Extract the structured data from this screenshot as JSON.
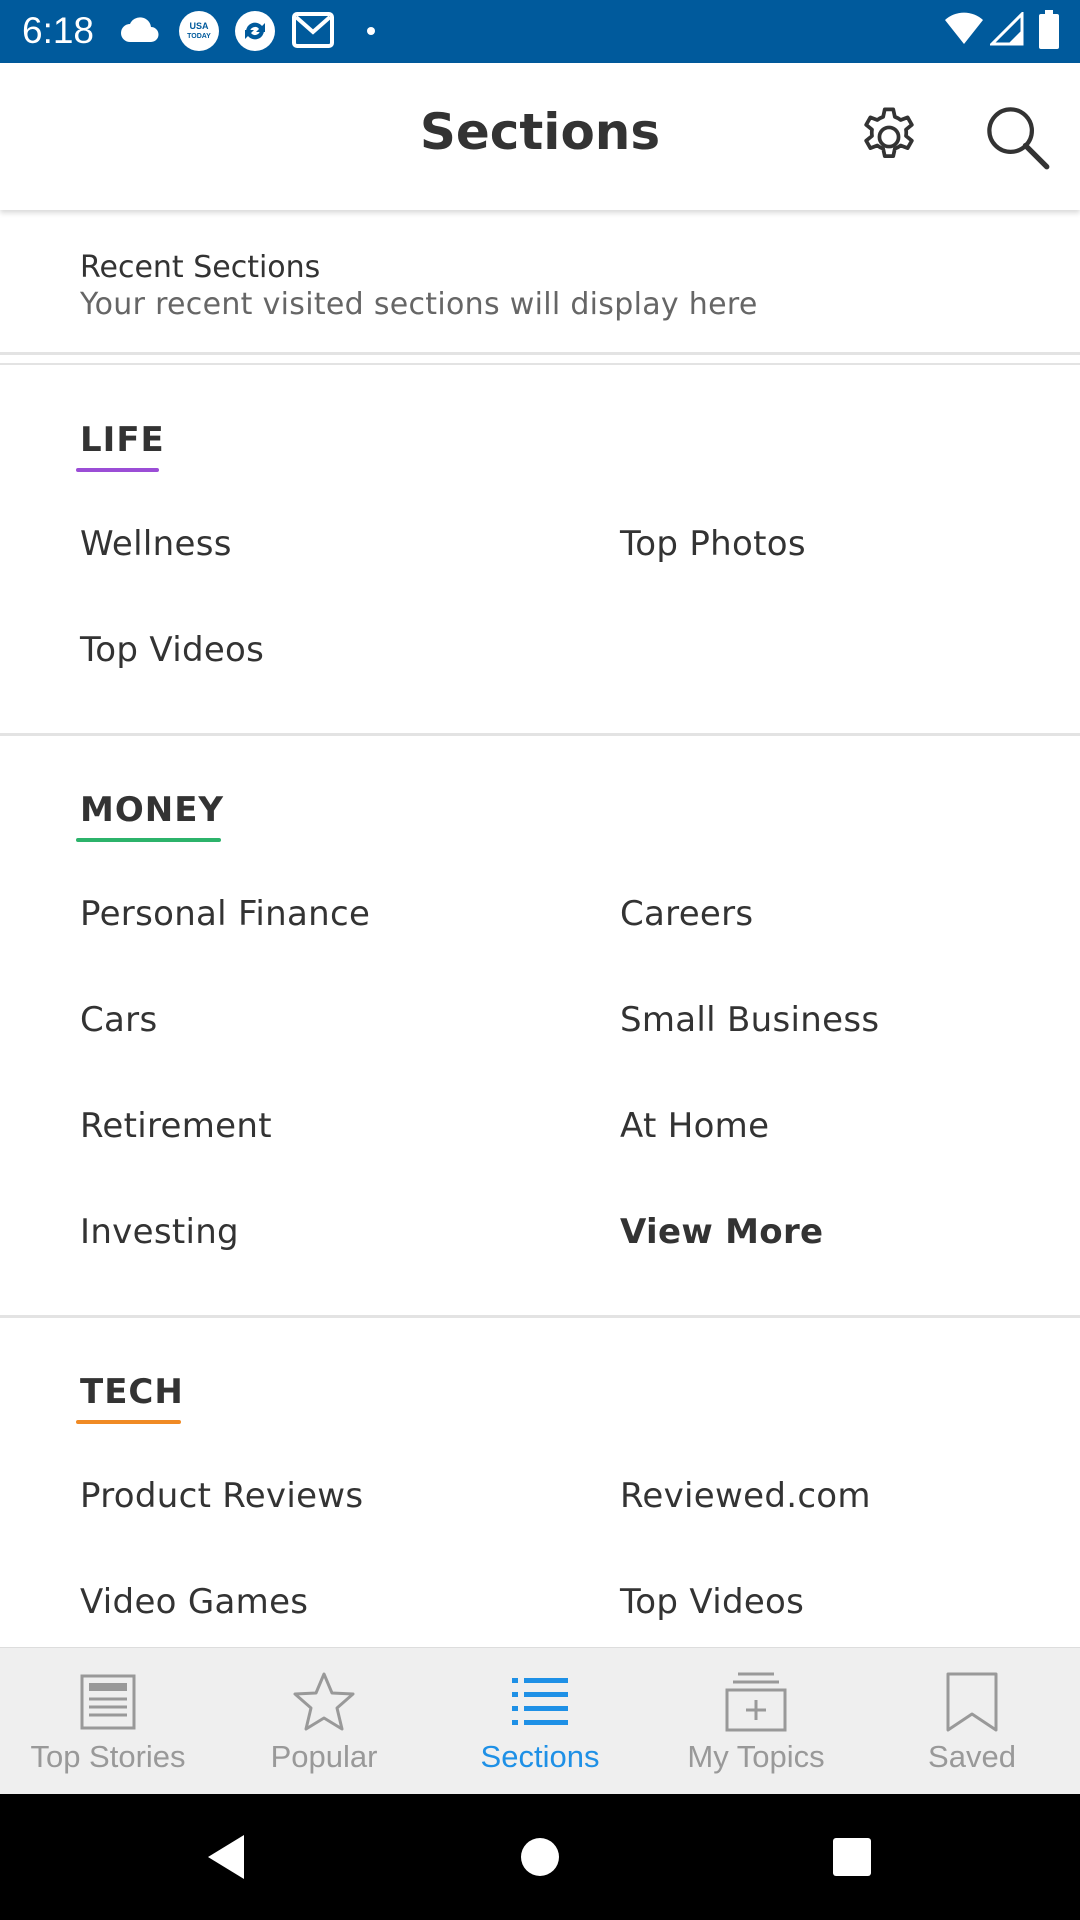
{
  "status_bar": {
    "time": "6:18",
    "icons": [
      "cloud-icon",
      "usa-today-icon",
      "sync-icon",
      "gmail-icon",
      "dot-icon",
      "wifi-icon",
      "signal-icon",
      "battery-icon"
    ],
    "usa_today_badge_line1": "USA",
    "usa_today_badge_line2": "TODAY",
    "background_color": "#005a9c"
  },
  "app_bar": {
    "title": "Sections",
    "settings_icon": "gear-icon",
    "search_icon": "search-icon"
  },
  "recent": {
    "title": "Recent Sections",
    "subtitle": "Your recent visited sections will display here"
  },
  "sections": [
    {
      "heading": "LIFE",
      "accent": "#9b4dd6",
      "items": [
        "Wellness",
        "Top Photos",
        "Top Videos"
      ]
    },
    {
      "heading": "MONEY",
      "accent": "#2cb36b",
      "items": [
        "Personal Finance",
        "Careers",
        "Cars",
        "Small Business",
        "Retirement",
        "At Home",
        "Investing",
        "View More"
      ]
    },
    {
      "heading": "TECH",
      "accent": "#f08a24",
      "items": [
        "Product Reviews",
        "Reviewed.com",
        "Video Games",
        "Top Videos"
      ]
    }
  ],
  "bottom_nav": {
    "items": [
      {
        "label": "Top Stories",
        "icon": "newspaper-icon",
        "active": false
      },
      {
        "label": "Popular",
        "icon": "star-icon",
        "active": false
      },
      {
        "label": "Sections",
        "icon": "list-icon",
        "active": true
      },
      {
        "label": "My Topics",
        "icon": "add-topic-icon",
        "active": false
      },
      {
        "label": "Saved",
        "icon": "bookmark-icon",
        "active": false
      }
    ],
    "active_color": "#1e90e6",
    "inactive_color": "#999999"
  },
  "system_nav": {
    "icons": [
      "back-icon",
      "home-icon",
      "recents-icon"
    ]
  }
}
